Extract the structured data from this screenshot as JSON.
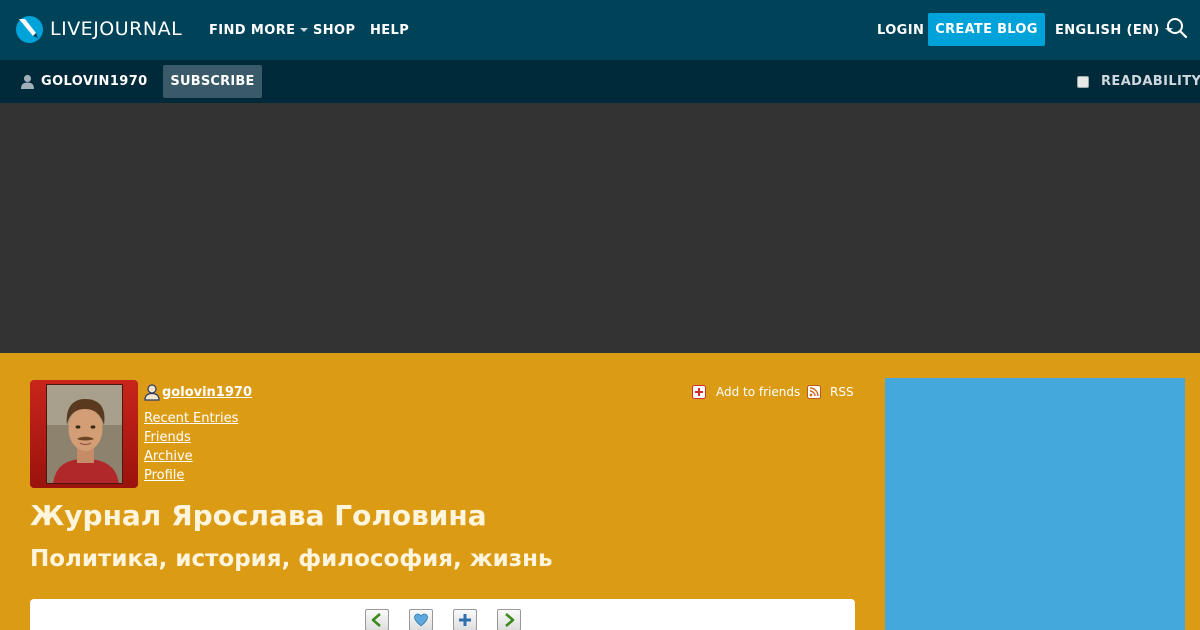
{
  "topbar": {
    "logo_text": "LIVEJOURNAL",
    "nav": [
      {
        "label": "FIND MORE",
        "has_dropdown": true
      },
      {
        "label": "SHOP",
        "has_dropdown": false
      },
      {
        "label": "HELP",
        "has_dropdown": false
      }
    ],
    "login_label": "LOGIN",
    "create_blog_label": "CREATE BLOG",
    "language_label": "ENGLISH (EN)",
    "search_icon": "search-icon"
  },
  "subbar": {
    "username": "GOLOVIN1970",
    "subscribe_label": "SUBSCRIBE",
    "readability_label": "READABILITY",
    "readability_checked": false
  },
  "profile": {
    "username": "golovin1970",
    "links": [
      "Recent Entries",
      "Friends",
      "Archive",
      "Profile"
    ],
    "add_friends_label": "Add to friends",
    "rss_label": "RSS",
    "journal_title": "Журнал Ярослава Головина",
    "journal_subtitle": "Политика, история, философия, жизнь"
  },
  "entry_controls": [
    "prev-entry-icon",
    "heart-icon",
    "plus-icon",
    "next-entry-icon"
  ],
  "colors": {
    "topbar_bg": "#004359",
    "subbar_bg": "#00293a",
    "accent": "#00a3d9",
    "page_bg": "#dc9b14",
    "ad_band_bg": "#333333",
    "side_ad_bg": "#45a8dc"
  }
}
